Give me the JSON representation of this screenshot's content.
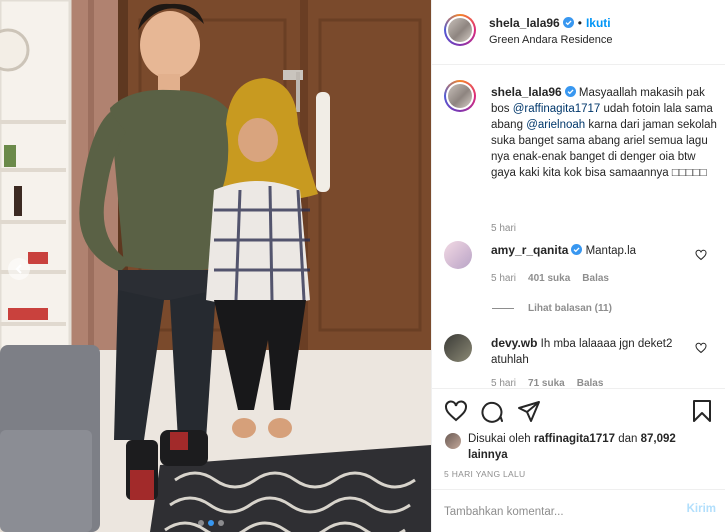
{
  "post": {
    "username": "shela_lala96",
    "follow_label": "Ikuti",
    "bullet": "•",
    "location": "Green Andara Residence"
  },
  "caption": {
    "username": "shela_lala96",
    "text_1": " Masyaallah makasih pak bos ",
    "mention_1": "@raffinagita1717",
    "text_2": " udah fotoin lala sama abang ",
    "mention_2": "@arielnoah",
    "text_3": " karna dari jaman sekolah suka banget sama abang ariel semua lagu nya enak-enak banget di denger oia btw gaya kaki kita kok bisa samaannya ",
    "emoji": "□□□□□",
    "time": "5 hari"
  },
  "comments": [
    {
      "username": "amy_r_qanita",
      "text": "Mantap.la",
      "time": "5 hari",
      "likes": "401 suka",
      "reply": "Balas"
    },
    {
      "username": "devy.wb",
      "text": "Ih mba lalaaaa jgn deket2 atuhlah",
      "time": "5 hari",
      "likes": "71 suka",
      "reply": "Balas"
    }
  ],
  "view_replies": "Lihat balasan (11)",
  "likes": {
    "prefix": "Disukai oleh ",
    "user": "raffinagita1717",
    "middle": " dan ",
    "count": "87,092",
    "suffix": " lainnya"
  },
  "date": "5 HARI YANG LALU",
  "add_comment": {
    "placeholder": "Tambahkan komentar...",
    "post_label": "Kirim"
  },
  "icons": {
    "like": "heart-icon",
    "comment": "comment-icon",
    "share": "paper-plane-icon",
    "save": "bookmark-icon",
    "verified": "verified-badge-icon"
  },
  "colors": {
    "accent": "#0095f6",
    "mention": "#00376b",
    "muted": "#8e8e8e",
    "post_disabled": "#b2dffc"
  },
  "carousel": {
    "total_slides": 3,
    "active_slide": 1
  }
}
